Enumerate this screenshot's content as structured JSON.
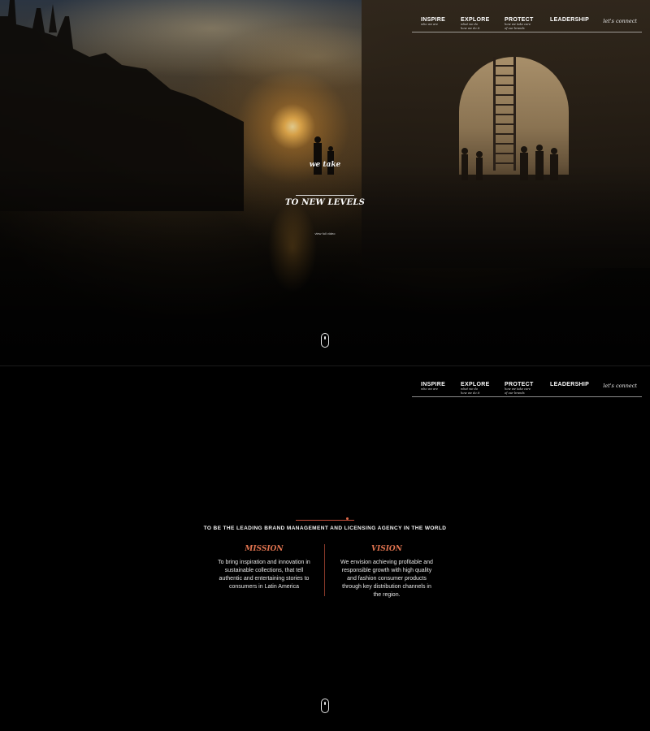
{
  "nav": {
    "items": [
      {
        "label": "INSPIRE",
        "sub": "who we are"
      },
      {
        "label": "EXPLORE",
        "sub1": "what we do",
        "sub2": "how we do it"
      },
      {
        "label": "PROTECT",
        "sub1": "how we take care",
        "sub2": "of our brands"
      },
      {
        "label": "LEADERSHIP"
      }
    ],
    "connect": "let's connect"
  },
  "hero": {
    "line1": "we take",
    "line2": "TO NEW LEVELS",
    "cta": "view full video"
  },
  "section2": {
    "headline": "TO BE THE LEADING BRAND MANAGEMENT AND LICENSING AGENCY IN THE WORLD",
    "mission": {
      "title": "MISSION",
      "lines": [
        "To bring inspiration and innovation in",
        "sustainable collections, that tell",
        "authentic and entertaining stories to",
        "consumers in Latin America"
      ]
    },
    "vision": {
      "title": "VISION",
      "lines": [
        "We envision achieving profitable and",
        "responsible growth with high quality",
        "and fashion consumer products",
        "through key distribution channels in",
        "the region."
      ]
    }
  },
  "icons": {
    "scroll": "mouse-scroll-icon"
  },
  "colors": {
    "accent": "#e0734f",
    "background": "#000000",
    "text": "#ffffff"
  }
}
